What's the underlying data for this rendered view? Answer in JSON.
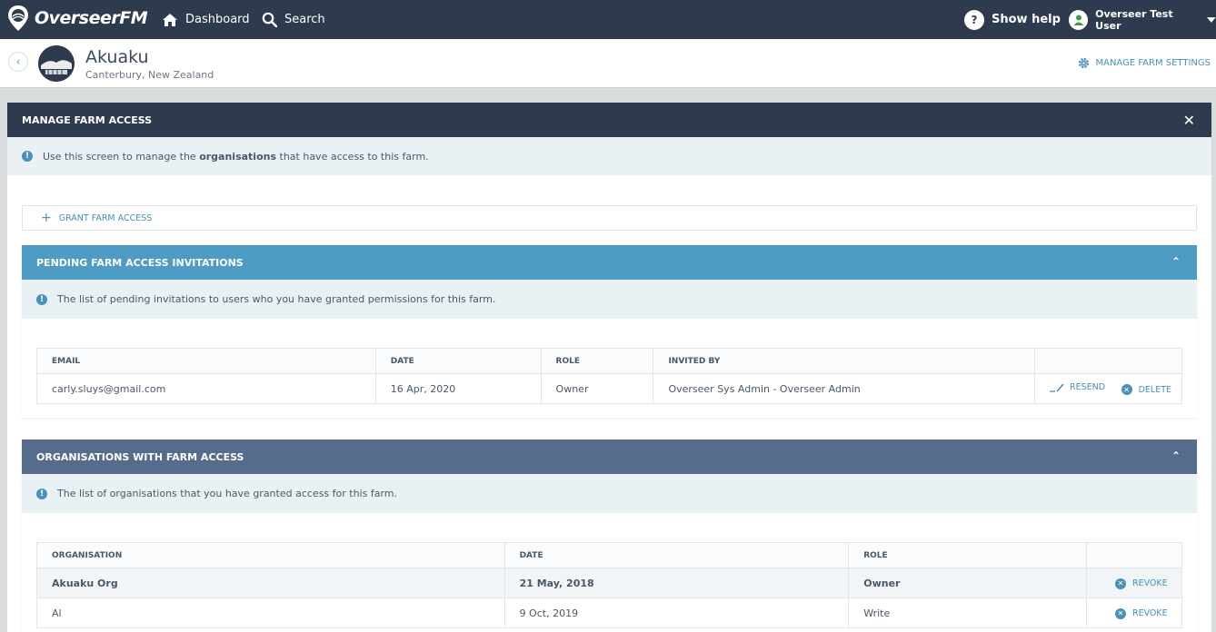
{
  "nav": {
    "brand": "OverseerFM",
    "dashboard": "Dashboard",
    "search": "Search",
    "help": "Show help",
    "user": "Overseer Test User"
  },
  "farm": {
    "name": "Akuaku",
    "location": "Canterbury, New Zealand",
    "manage_settings": "MANAGE FARM SETTINGS"
  },
  "panel": {
    "title": "MANAGE FARM ACCESS",
    "info_prefix": "Use this screen to manage the ",
    "info_bold": "organisations",
    "info_suffix": " that have access to this farm.",
    "grant": "GRANT FARM ACCESS"
  },
  "pending": {
    "title": "PENDING FARM ACCESS INVITATIONS",
    "info": "The list of pending invitations to users who you have granted permissions for this farm.",
    "columns": [
      "EMAIL",
      "DATE",
      "ROLE",
      "INVITED BY",
      ""
    ],
    "rows": [
      {
        "email": "carly.sluys@gmail.com",
        "date": "16 Apr, 2020",
        "role": "Owner",
        "invited_by": "Overseer Sys Admin - Overseer Admin",
        "resend": "RESEND",
        "delete": "DELETE"
      }
    ]
  },
  "orgs": {
    "title": "ORGANISATIONS WITH FARM ACCESS",
    "info": "The list of organisations that you have granted access for this farm.",
    "columns": [
      "ORGANISATION",
      "DATE",
      "ROLE",
      ""
    ],
    "rows": [
      {
        "name": "Akuaku Org",
        "date": "21 May, 2018",
        "role": "Owner",
        "action": "REVOKE"
      },
      {
        "name": "Al",
        "date": "9 Oct, 2019",
        "role": "Write",
        "action": "REVOKE"
      }
    ]
  },
  "colors": {
    "nav_bg": "#2e3a4d",
    "pending_header": "#4e9bc4",
    "orgs_header": "#566c8c",
    "accent": "#4a90b8"
  }
}
